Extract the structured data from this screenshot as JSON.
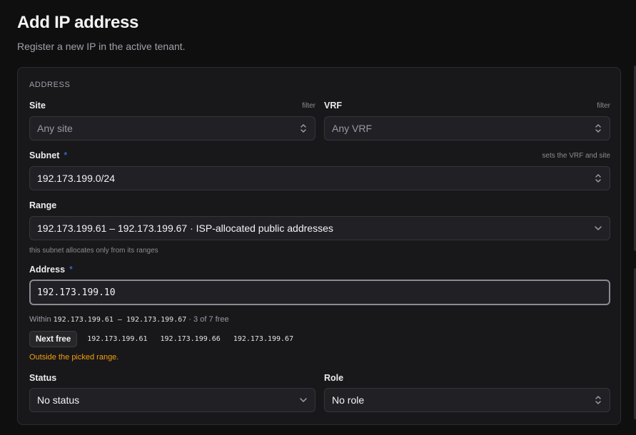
{
  "header": {
    "title": "Add IP address",
    "subtitle": "Register a new IP in the active tenant."
  },
  "form": {
    "section": "ADDRESS",
    "site": {
      "label": "Site",
      "hint": "filter",
      "placeholder": "Any site"
    },
    "vrf": {
      "label": "VRF",
      "hint": "filter",
      "placeholder": "Any VRF"
    },
    "subnet": {
      "label": "Subnet",
      "required_mark": "*",
      "hint": "sets the VRF and site",
      "value": "192.173.199.0/24"
    },
    "range": {
      "label": "Range",
      "value": "192.173.199.61 – 192.173.199.67 · ISP-allocated public addresses",
      "help": "this subnet allocates only from its ranges"
    },
    "address": {
      "label": "Address",
      "required_mark": "*",
      "value": "192.173.199.10",
      "within_prefix": "Within",
      "within_range": "192.173.199.61 – 192.173.199.67",
      "within_suffix": "· 3 of 7 free",
      "next_free_label": "Next free",
      "suggestions": [
        "192.173.199.61",
        "192.173.199.66",
        "192.173.199.67"
      ],
      "warning": "Outside the picked range."
    },
    "status": {
      "label": "Status",
      "value": "No status"
    },
    "role": {
      "label": "Role",
      "value": "No role"
    }
  },
  "colors": {
    "background": "#0f0f10",
    "card": "#18181b",
    "required": "#3b82f6",
    "warning": "#f59e0b"
  }
}
